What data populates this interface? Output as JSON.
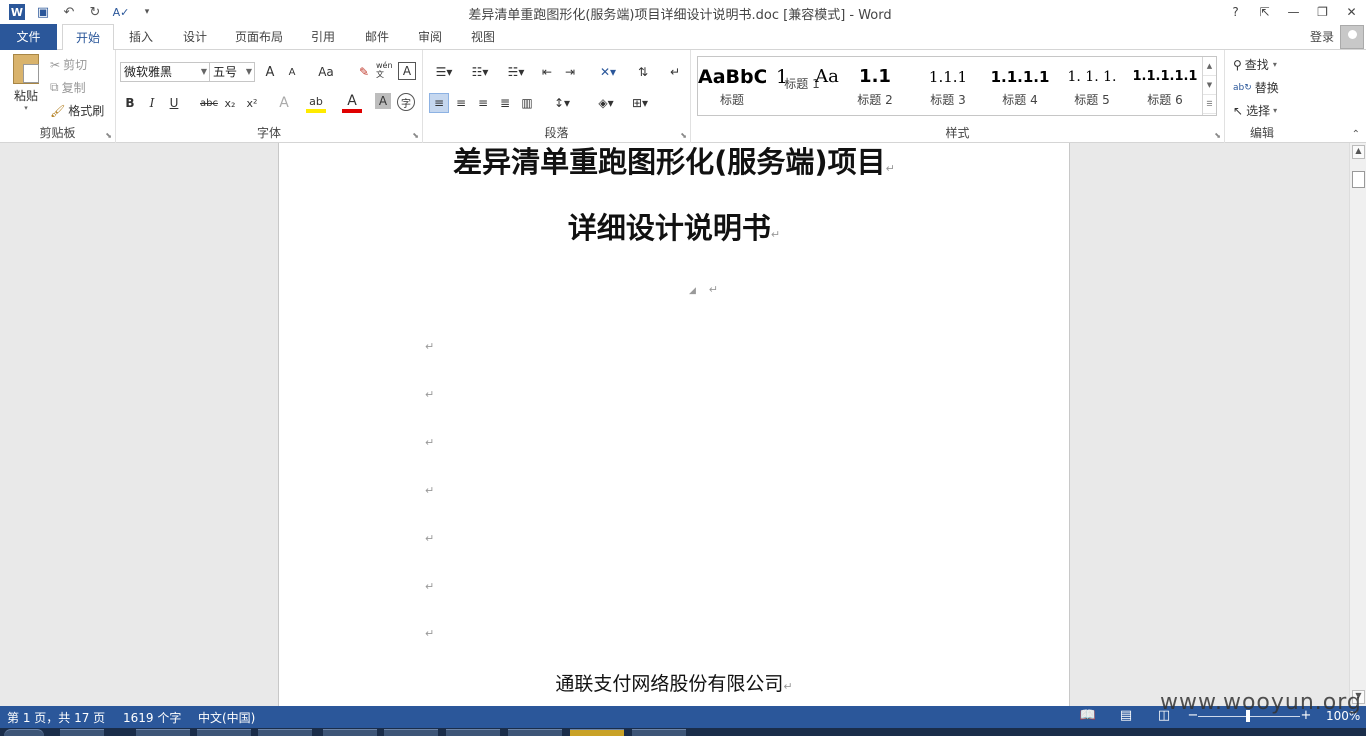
{
  "window": {
    "title": "差异清单重跑图形化(服务端)项目详细设计说明书.doc [兼容模式] - Word",
    "help": "?",
    "ribbon_display": "⇱",
    "minimize": "—",
    "restore": "❐",
    "close": "✕"
  },
  "qat": {
    "logo": "W",
    "save": "💾",
    "undo": "↶",
    "redo": "↻",
    "spell": "A✓",
    "customize": "▾"
  },
  "tabs": [
    "文件",
    "开始",
    "插入",
    "设计",
    "页面布局",
    "引用",
    "邮件",
    "审阅",
    "视图"
  ],
  "active_tab": "开始",
  "account": {
    "login": "登录"
  },
  "ribbon": {
    "clipboard": {
      "label": "剪贴板",
      "paste": "粘贴",
      "cut": "剪切",
      "copy": "复制",
      "format_painter": "格式刷"
    },
    "font": {
      "label": "字体",
      "font_name": "微软雅黑",
      "font_size": "五号",
      "grow": "A",
      "shrink": "A",
      "change_case": "Aa",
      "clear": "✎",
      "phonetic": "wén 文",
      "border": "A",
      "bold": "B",
      "italic": "I",
      "underline": "U",
      "strike": "abc",
      "sub": "x₂",
      "sup": "x²",
      "effects": "A",
      "highlight": "ab",
      "font_color": "A",
      "shading": "A",
      "enclose": "字"
    },
    "paragraph": {
      "label": "段落"
    },
    "styles": {
      "label": "样式",
      "items": [
        {
          "sample": "AaBbC",
          "name": "标题"
        },
        {
          "sample": "1",
          "name": "标题 1"
        },
        {
          "sample": "Aa",
          "name": "标题 2"
        },
        {
          "sample": "1.1",
          "name": "标题 2"
        },
        {
          "sample": "1.1.1",
          "name": "标题 3"
        },
        {
          "sample": "1.1.1.1",
          "name": "标题 4"
        },
        {
          "sample": "1. 1. 1.",
          "name": "标题 5"
        },
        {
          "sample": "1.1.1.1.1",
          "name": "标题 6"
        }
      ]
    },
    "editing": {
      "label": "编辑",
      "find": "查找",
      "replace": "替换",
      "select": "选择"
    }
  },
  "document": {
    "title_line1": "差异清单重跑图形化(服务端)项目",
    "title_line2": "详细设计说明书",
    "paragraph_mark": "↵",
    "company": "通联支付网络股份有限公司"
  },
  "status": {
    "page": "第 1 页，共 17 页",
    "words": "1619 个字",
    "language": "中文(中国)",
    "zoom": "100%"
  },
  "watermark": "www.wooyun.org",
  "colors": {
    "accent": "#2b579a"
  }
}
